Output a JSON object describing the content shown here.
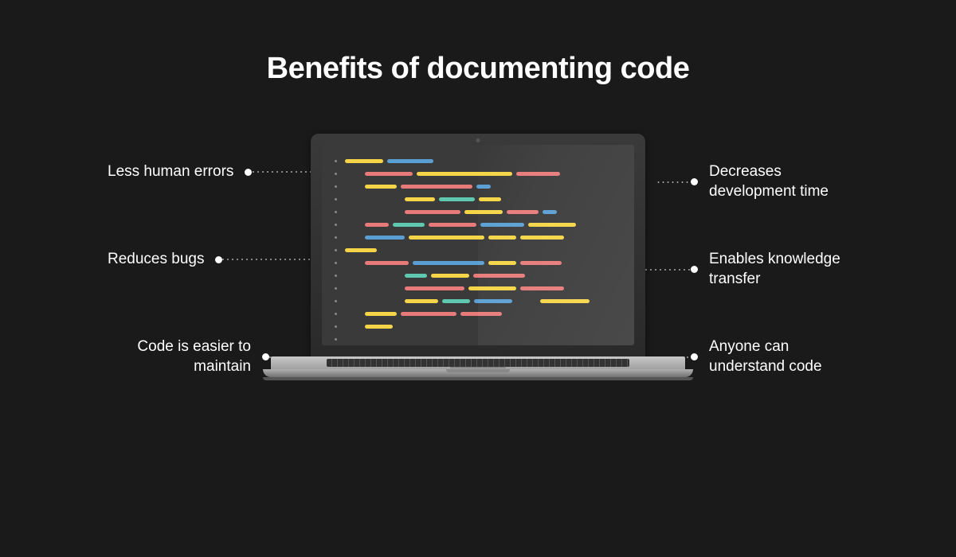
{
  "title": "Benefits of documenting code",
  "benefits": {
    "left": [
      "Less human errors",
      "Reduces bugs",
      "Code is easier to maintain"
    ],
    "right": [
      "Decreases development time",
      "Enables knowledge transfer",
      "Anyone can understand code"
    ]
  },
  "code_colors": {
    "yellow": "#f5d547",
    "pink": "#e87a7a",
    "blue": "#5a9fd4",
    "teal": "#5fc9b0"
  }
}
